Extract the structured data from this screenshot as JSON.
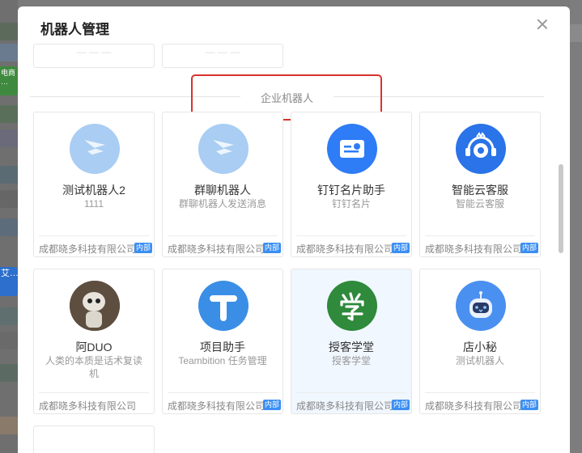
{
  "modal": {
    "title": "机器人管理"
  },
  "section": {
    "title": "企业机器人"
  },
  "cards": [
    {
      "name": "测试机器人2",
      "desc": "1111",
      "company": "成都晓多科技有限公司",
      "badge": "内部",
      "icon": "robot-icon"
    },
    {
      "name": "群聊机器人",
      "desc": "群聊机器人发送消息",
      "company": "成都晓多科技有限公司",
      "badge": "内部",
      "icon": "robot-icon"
    },
    {
      "name": "钉钉名片助手",
      "desc": "钉钉名片",
      "company": "成都晓多科技有限公司",
      "badge": "内部",
      "icon": "namecard-icon"
    },
    {
      "name": "智能云客服",
      "desc": "智能云客服",
      "company": "成都晓多科技有限公司",
      "badge": "内部",
      "icon": "headset-robot-icon"
    },
    {
      "name": "阿DUO",
      "desc": "人类的本质是话术复读机",
      "company": "成都晓多科技有限公司",
      "badge": "",
      "icon": "robot-photo-icon"
    },
    {
      "name": "项目助手",
      "desc": "Teambition 任务管理",
      "company": "成都晓多科技有限公司",
      "badge": "内部",
      "icon": "teambition-icon"
    },
    {
      "name": "授客学堂",
      "desc": "授客学堂",
      "company": "成都晓多科技有限公司",
      "badge": "内部",
      "icon": "xue-icon"
    },
    {
      "name": "店小秘",
      "desc": "测试机器人",
      "company": "成都晓多科技有限公司",
      "badge": "内部",
      "icon": "bot-face-icon"
    }
  ],
  "background": {
    "left_tag_1": "电商 …",
    "left_tag_2": "艾…"
  },
  "colors": {
    "accent": "#3b8ff3",
    "highlight_border": "#d9322b",
    "ding_blue": "#2e7cf6",
    "xue_green": "#2f8a3c"
  }
}
